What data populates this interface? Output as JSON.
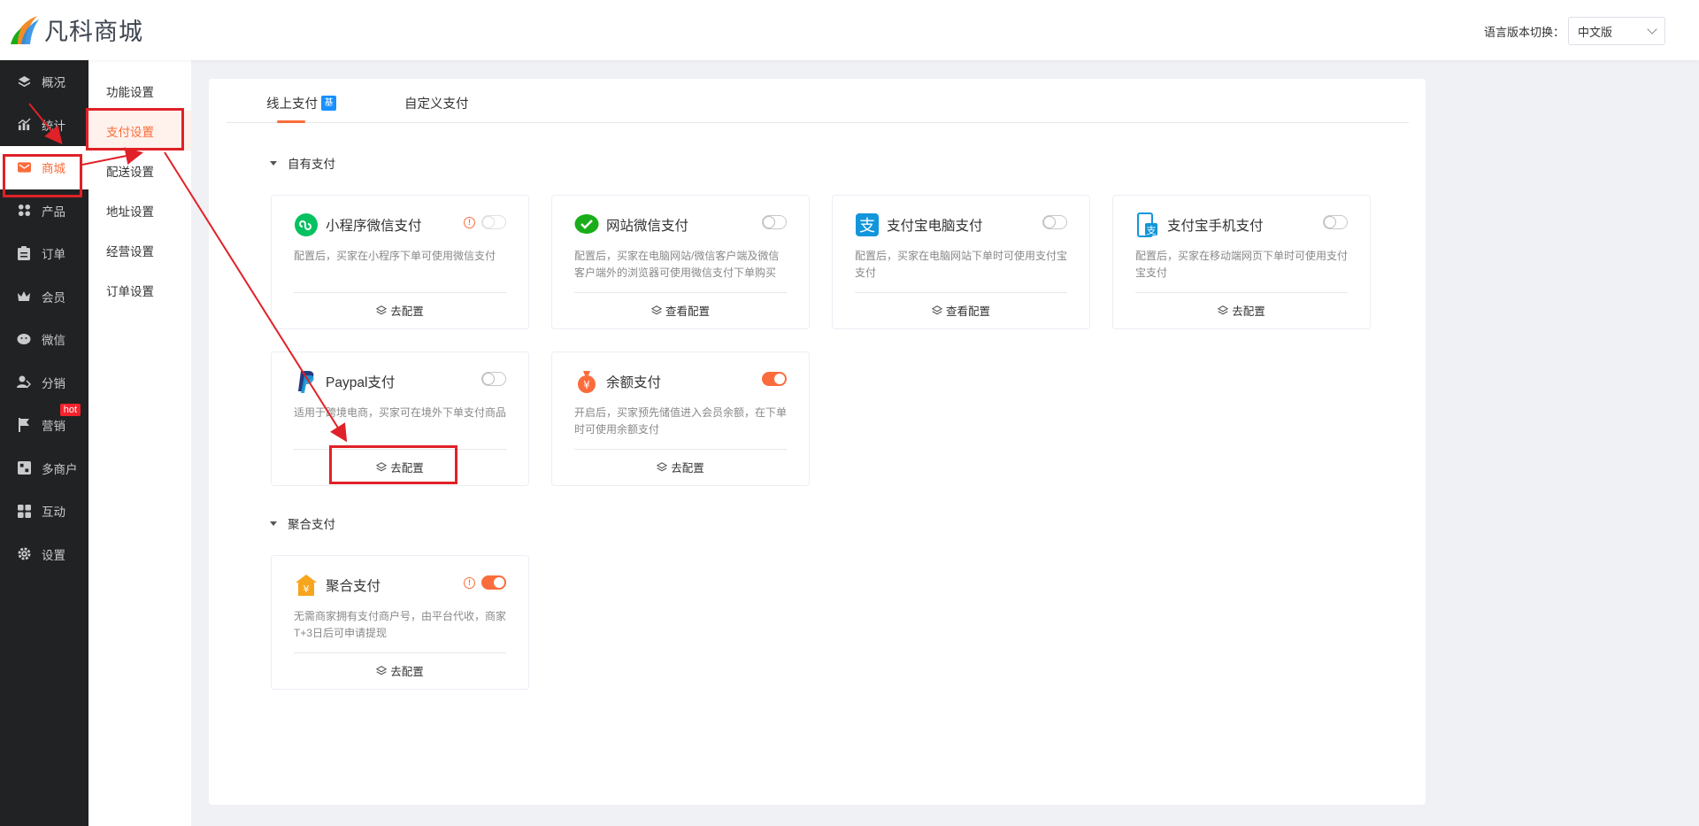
{
  "header": {
    "brand": "凡科商城",
    "lang_label": "语言版本切换：",
    "lang_value": "中文版"
  },
  "sidebar": {
    "items": [
      {
        "label": "概况",
        "icon": "layers-icon"
      },
      {
        "label": "统计",
        "icon": "chart-icon"
      },
      {
        "label": "商城",
        "icon": "mail-icon"
      },
      {
        "label": "产品",
        "icon": "grid-icon"
      },
      {
        "label": "订单",
        "icon": "clipboard-icon"
      },
      {
        "label": "会员",
        "icon": "crown-icon"
      },
      {
        "label": "微信",
        "icon": "wechat-icon"
      },
      {
        "label": "分销",
        "icon": "users-icon"
      },
      {
        "label": "营销",
        "icon": "flag-icon",
        "badge": "hot"
      },
      {
        "label": "多商户",
        "icon": "store-icon"
      },
      {
        "label": "互动",
        "icon": "blocks-icon"
      },
      {
        "label": "设置",
        "icon": "gear-icon"
      }
    ]
  },
  "submenu": {
    "items": [
      "功能设置",
      "支付设置",
      "配送设置",
      "地址设置",
      "经营设置",
      "订单设置"
    ]
  },
  "tabs": {
    "online": "线上支付",
    "online_badge": "基",
    "custom": "自定义支付"
  },
  "sections": {
    "own": "自有支付",
    "aggregate": "聚合支付"
  },
  "cards": [
    {
      "title": "小程序微信支付",
      "desc": "配置后，买家在小程序下单可使用微信支付",
      "action": "去配置",
      "icon": "miniprogram-icon",
      "color": "#07c160"
    },
    {
      "title": "网站微信支付",
      "desc": "配置后，买家在电脑网站/微信客户端及微信客户端外的浏览器可使用微信支付下单购买",
      "action": "查看配置",
      "icon": "wechat-pay-icon",
      "color": "#1aad19"
    },
    {
      "title": "支付宝电脑支付",
      "desc": "配置后，买家在电脑网站下单时可使用支付宝支付",
      "action": "查看配置",
      "icon": "alipay-icon",
      "color": "#1296db"
    },
    {
      "title": "支付宝手机支付",
      "desc": "配置后，买家在移动端网页下单时可使用支付宝支付",
      "action": "去配置",
      "icon": "alipay-mobile-icon",
      "color": "#1296db"
    },
    {
      "title": "Paypal支付",
      "desc": "适用于跨境电商，买家可在境外下单支付商品",
      "action": "去配置",
      "icon": "paypal-icon",
      "color": "#253b80"
    },
    {
      "title": "余额支付",
      "desc": "开启后，买家预先储值进入会员余额，在下单时可使用余额支付",
      "action": "去配置",
      "icon": "money-bag-icon",
      "color": "#fa6c3c"
    },
    {
      "title": "聚合支付",
      "desc": "无需商家拥有支付商户号，由平台代收，商家T+3日后可申请提现",
      "action": "去配置",
      "icon": "aggregate-pay-icon",
      "color": "#f7a51c"
    }
  ]
}
